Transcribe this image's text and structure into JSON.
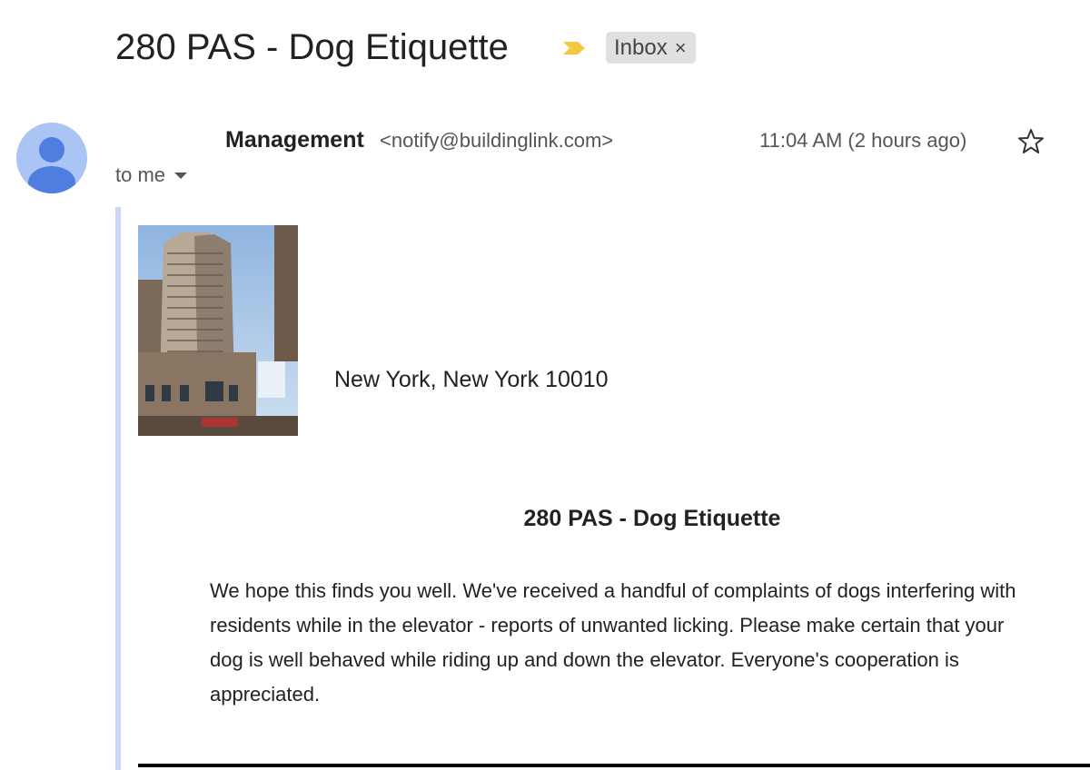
{
  "email": {
    "subject": "280 PAS - Dog Etiquette",
    "label": "Inbox",
    "label_close": "×"
  },
  "sender": {
    "name": "Management",
    "email": "<notify@buildinglink.com>",
    "timestamp": "11:04 AM (2 hours ago)",
    "recipient": "to me"
  },
  "body": {
    "address": "New York, New York 10010",
    "heading": "280 PAS - Dog Etiquette",
    "lines": [
      "We hope this finds you well.  We've received a handful of complaints of dogs interfering with",
      "residents while in the elevator - reports of unwanted licking.  Please make certain that your",
      "dog is well behaved while riding up and down the elevator.  Everyone's cooperation is",
      "appreciated."
    ]
  },
  "icons": {
    "importance": "importance-marker-icon",
    "star": "star-icon",
    "avatar": "default-avatar-icon",
    "caret": "caret-down-icon"
  },
  "colors": {
    "importance": "#f4c842",
    "avatar_bg": "#aac4f3",
    "avatar_fg": "#4f7de0",
    "label_bg": "#e0e0e0",
    "quote_bar": "#cad6f5"
  }
}
